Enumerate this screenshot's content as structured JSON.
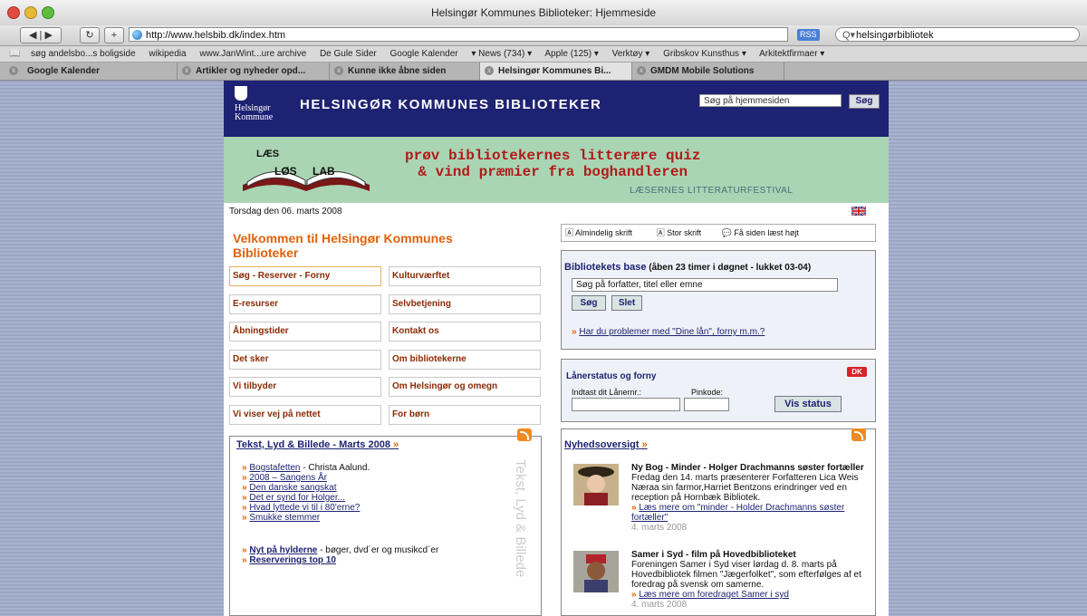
{
  "window": {
    "title": "Helsingør Kommunes Biblioteker: Hjemmeside"
  },
  "toolbar": {
    "url": "http://www.helsbib.dk/index.htm",
    "rss": "RSS",
    "search_value": "helsingørbibliotek"
  },
  "bookmarks": [
    "søg andelsbo...s boligside",
    "wikipedia",
    "www.JanWint...ure archive",
    "De Gule Sider",
    "Google Kalender",
    "▾ News (734) ▾",
    "Apple (125) ▾",
    "Verktøy ▾",
    "Gribskov Kunsthus ▾",
    "Arkitektfirmaer ▾"
  ],
  "tabs": [
    {
      "label": "Google Kalender"
    },
    {
      "label": "Artikler og nyheder opd..."
    },
    {
      "label": "Kunne ikke åbne siden"
    },
    {
      "label": "Helsingør Kommunes Bi..."
    },
    {
      "label": "GMDM Mobile Solutions"
    }
  ],
  "site": {
    "logo": {
      "line1": "Helsingør",
      "line2": "Kommune"
    },
    "title": "HELSINGØR KOMMUNES BIBLIOTEKER",
    "search_placeholder": "Søg på hjemmesiden",
    "search_button": "Søg"
  },
  "banner": {
    "logo_top": "LÆS",
    "logo_left": "LØS",
    "logo_right": "LAB",
    "line1": "prøv bibliotekernes litterære quiz",
    "line2": "& vind præmier fra boghandleren",
    "sub": "LÆSERNES LITTERATURFESTIVAL"
  },
  "date": "Torsdag den 06. marts 2008",
  "welcome": "Velkommen til Helsingør Kommunes Biblioteker",
  "links": [
    "Søg - Reserver - Forny",
    "Kulturværftet",
    "E-resurser",
    "Selvbetjening",
    "Åbningstider",
    "Kontakt os",
    "Det sker",
    "Om bibliotekerne",
    "Vi tilbyder",
    "Om Helsingør og omegn",
    "Vi viser vej på nettet",
    "For børn"
  ],
  "tlb": {
    "title": "Tekst, Lyd & Billede - Marts 2008",
    "arrow": "»",
    "items": [
      {
        "link": "Bogstafetten",
        "text": " - Christa Aalund."
      },
      {
        "link": "2008 – Sangens År",
        "text": ""
      },
      {
        "link": "Den danske sangskat",
        "text": ""
      },
      {
        "link": "Det er synd for Holger...",
        "text": ""
      },
      {
        "link": "Hvad lyttede vi til i 80'erne?",
        "text": ""
      },
      {
        "link": "Smukke stemmer",
        "text": ""
      }
    ],
    "items2": [
      {
        "link": "Nyt på hylderne",
        "text": " - bøger, dvd´er og musikcd´er"
      },
      {
        "link": "Reserverings top 10",
        "text": ""
      }
    ],
    "vertical": "Tekst, Lyd & Billede"
  },
  "fontbar": {
    "normal": "Almindelig skrift",
    "large": "Stor skrift",
    "read": "Få siden læst højt"
  },
  "base": {
    "title": "Bibliotekets base",
    "hours": "(åben 23 timer i døgnet - lukket 03-04)",
    "placeholder": "Søg på forfatter, titel eller emne",
    "search": "Søg",
    "clear": "Slet",
    "help": "Har du problemer med \"Dine lån\", forny m.m.?"
  },
  "loan": {
    "title": "Lånerstatus og forny",
    "label_nr": "Indtast dit Lånernr.:",
    "label_pin": "Pinkode:",
    "button": "Vis status",
    "dk": "DK"
  },
  "news": {
    "title": "Nyhedsoversigt",
    "arrow": "»",
    "items": [
      {
        "title": "Ny Bog - Minder - Holger Drachmanns søster fortæller",
        "body": "Fredag den 14. marts præsenterer Forfatteren Lica Weis Næraa sin farmor,Harriet Bentzons erindringer ved en reception på Hornbæk Bibliotek.",
        "more": "Læs mere om \"minder - Holder Drachmanns søster fortæller\"",
        "date": "4. marts 2008"
      },
      {
        "title": "Samer i Syd - film på Hovedbiblioteket",
        "body": "Foreningen Samer i Syd viser lørdag d. 8. marts på Hovedbibliotek filmen \"Jægerfolket\", som efterfølges af et foredrag på svensk om samerne.",
        "more": "Læs mere om foredraget Samer i syd",
        "date": "4. marts 2008"
      }
    ]
  }
}
